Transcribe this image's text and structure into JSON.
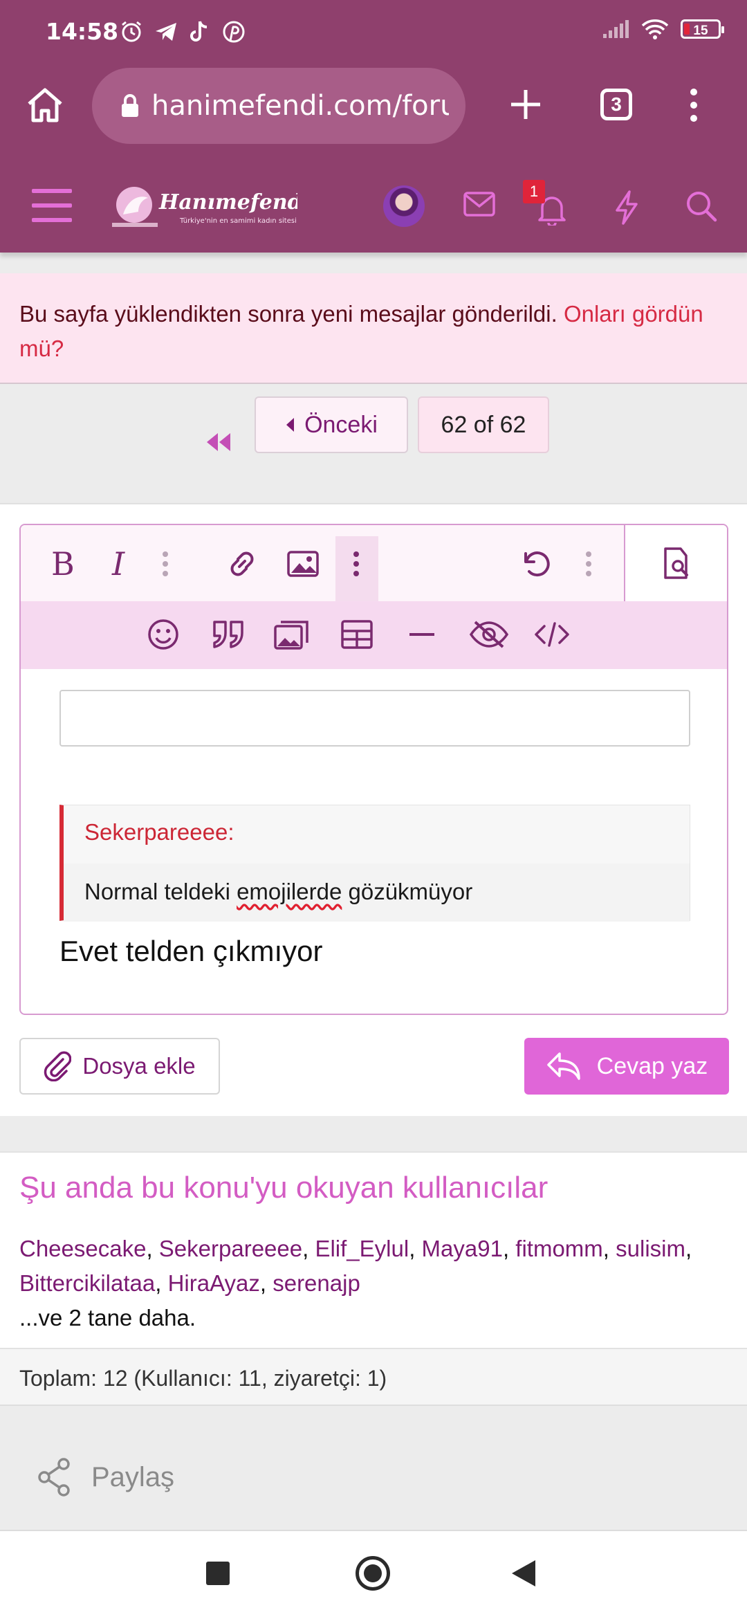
{
  "status_bar": {
    "time": "14:58",
    "battery_level": "15",
    "app_icons": [
      "alarm-icon",
      "telegram-icon",
      "tiktok-icon",
      "pinterest-icon"
    ]
  },
  "browser": {
    "url": "hanimefendi.com/foru",
    "tab_count": "3"
  },
  "site_header": {
    "logo_text": "Hanımefendi.com",
    "logo_tagline": "Türkiye'nin en samimi kadın sitesi",
    "notification_count": "1"
  },
  "notice": {
    "text": "Bu sayfa yüklendikten sonra yeni mesajlar gönderildi.",
    "link": "Onları gördün mü?"
  },
  "pagination": {
    "prev_label": "Önceki",
    "page_info": "62 of 62"
  },
  "editor": {
    "quote_author": "Sekerpareeee:",
    "quote_text_before": "Normal teldeki ",
    "quote_text_misspelled": "emojilerde",
    "quote_text_after": " gözükmüyor",
    "reply_text": "Evet telden çıkmıyor"
  },
  "actions": {
    "attach_label": "Dosya ekle",
    "reply_label": "Cevap yaz"
  },
  "readers": {
    "title": "Şu anda bu konu'yu okuyan kullanıcılar",
    "users": [
      "Cheesecake",
      "Sekerpareeee",
      "Elif_Eylul",
      "Maya91",
      "fitmomm",
      "sulisim",
      "Bittercikilataa",
      "HiraAyaz",
      "serenajp"
    ],
    "more": "...ve 2 tane daha.",
    "total": "Toplam: 12 (Kullanıcı: 11, ziyaretçi: 1)"
  },
  "share": {
    "label": "Paylaş"
  },
  "colors": {
    "header_bg": "#8f406d",
    "accent_pink": "#e066d8",
    "link_purple": "#7b1a72",
    "notice_bg": "#fde4f0",
    "alert_red": "#d62a44"
  }
}
